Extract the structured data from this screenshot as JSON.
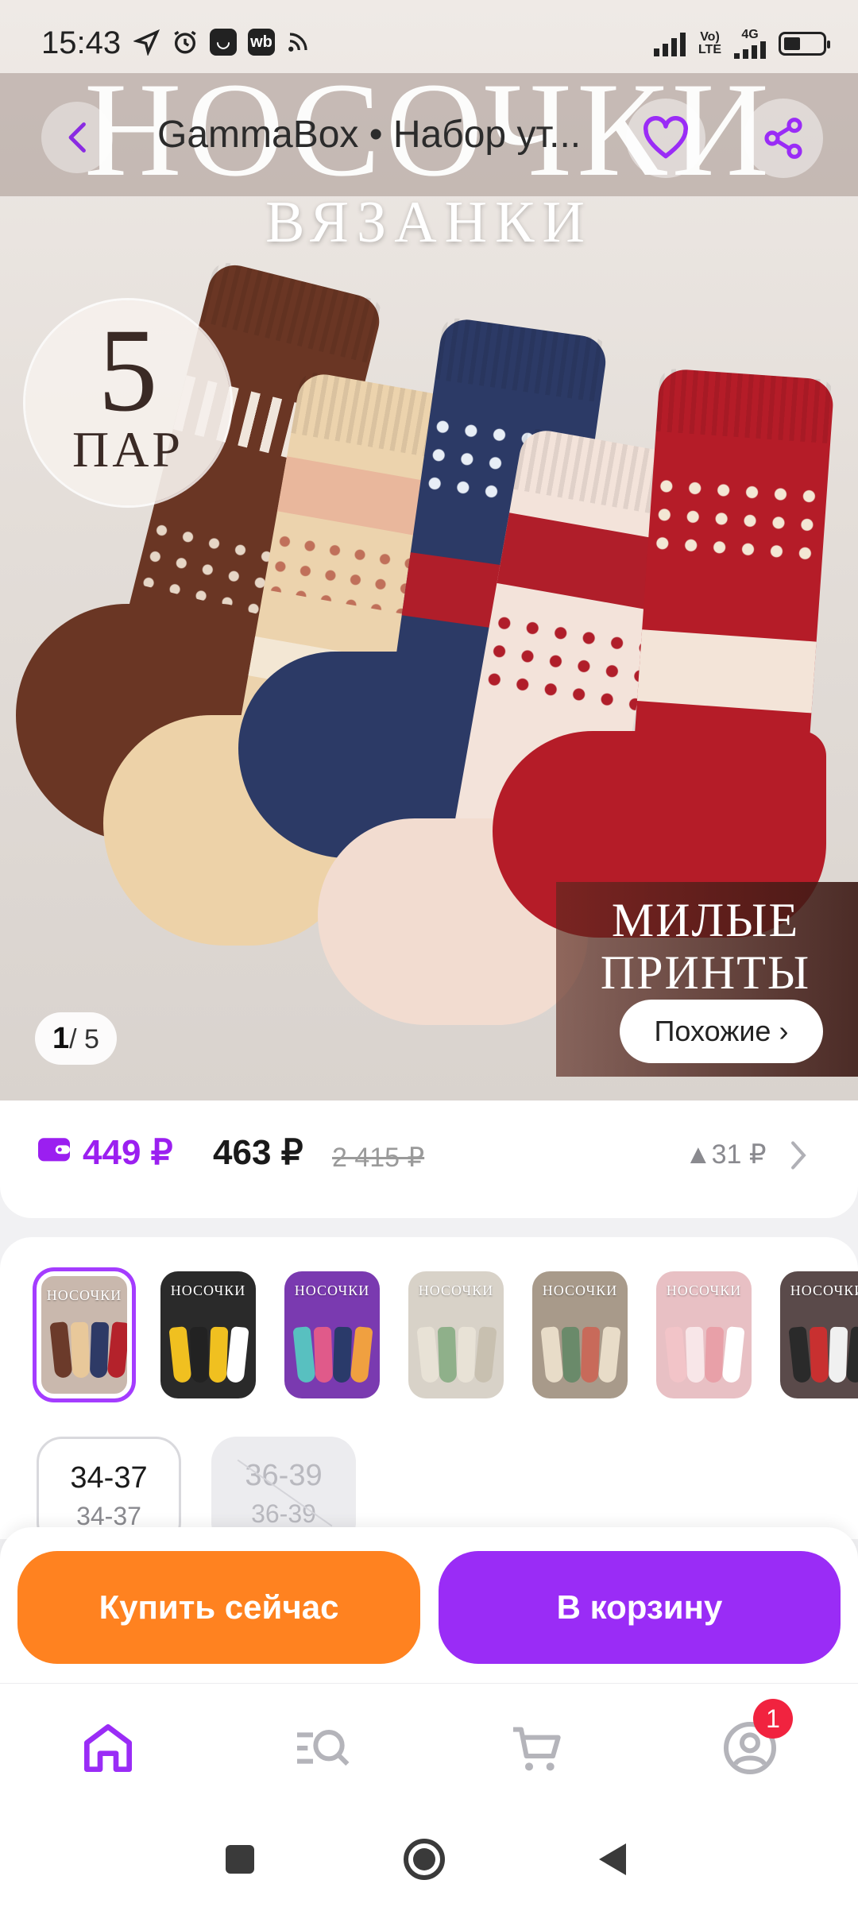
{
  "status_bar": {
    "time": "15:43",
    "network_label": "LTE",
    "network_4g": "4G"
  },
  "header": {
    "title": "GammaBox • Набор ут..."
  },
  "hero": {
    "big_title": "НОСОЧКИ",
    "subtitle": "ВЯЗАНКИ",
    "badge_number": "5",
    "badge_word": "ПАР",
    "promo_text": "МИЛЫЕ ПРИНТЫ",
    "page_current": "1",
    "page_total": "/ 5",
    "similar_label": "Похожие ›"
  },
  "price": {
    "wallet_price": "449 ₽",
    "main_price": "463 ₽",
    "old_price": "2 415 ₽",
    "difference": "▲31 ₽"
  },
  "variants": {
    "thumbnails": [
      {
        "label": "НОСОЧКИ",
        "colors": [
          "#6b3a2a",
          "#e8c89a",
          "#2e3a66",
          "#b4222b"
        ],
        "bg": "#c9b8ad"
      },
      {
        "label": "НОСОЧКИ",
        "colors": [
          "#f0c020",
          "#222222",
          "#f0c020",
          "#ffffff"
        ],
        "bg": "#2a2a2a"
      },
      {
        "label": "НОСОЧКИ",
        "colors": [
          "#58c0c0",
          "#e05a8a",
          "#2a3a6a",
          "#f0a040"
        ],
        "bg": "#7a3ab0"
      },
      {
        "label": "НОСОЧКИ",
        "colors": [
          "#e8e2d6",
          "#8fb08a",
          "#e8e2d6",
          "#c8c0b0"
        ],
        "bg": "#d8d2c8"
      },
      {
        "label": "НОСОЧКИ",
        "colors": [
          "#e8dcc8",
          "#6a8a6a",
          "#c86a5a",
          "#e8dcc8"
        ],
        "bg": "#a89a8a"
      },
      {
        "label": "НОСОЧКИ",
        "colors": [
          "#f2c4c8",
          "#f8e6e8",
          "#e8a0a8",
          "#ffffff"
        ],
        "bg": "#e8c0c4"
      },
      {
        "label": "НОСОЧКИ",
        "colors": [
          "#2a2a2a",
          "#c83030",
          "#f0f0f0",
          "#2a2a2a"
        ],
        "bg": "#5a4a4a"
      }
    ],
    "sizes": [
      {
        "primary": "34-37",
        "secondary": "34-37",
        "available": true
      },
      {
        "primary": "36-39",
        "secondary": "36-39",
        "available": false
      }
    ]
  },
  "actions": {
    "buy_now": "Купить сейчас",
    "add_to_cart": "В корзину"
  },
  "bottom_nav": {
    "items": [
      {
        "icon": "home-icon",
        "active": true
      },
      {
        "icon": "catalog-search-icon",
        "active": false
      },
      {
        "icon": "cart-icon",
        "active": false
      },
      {
        "icon": "profile-icon",
        "active": false
      }
    ],
    "profile_badge": "1"
  },
  "colors": {
    "accent_purple": "#9a2cf6",
    "accent_orange": "#ff8220",
    "badge_red": "#f1233f"
  }
}
